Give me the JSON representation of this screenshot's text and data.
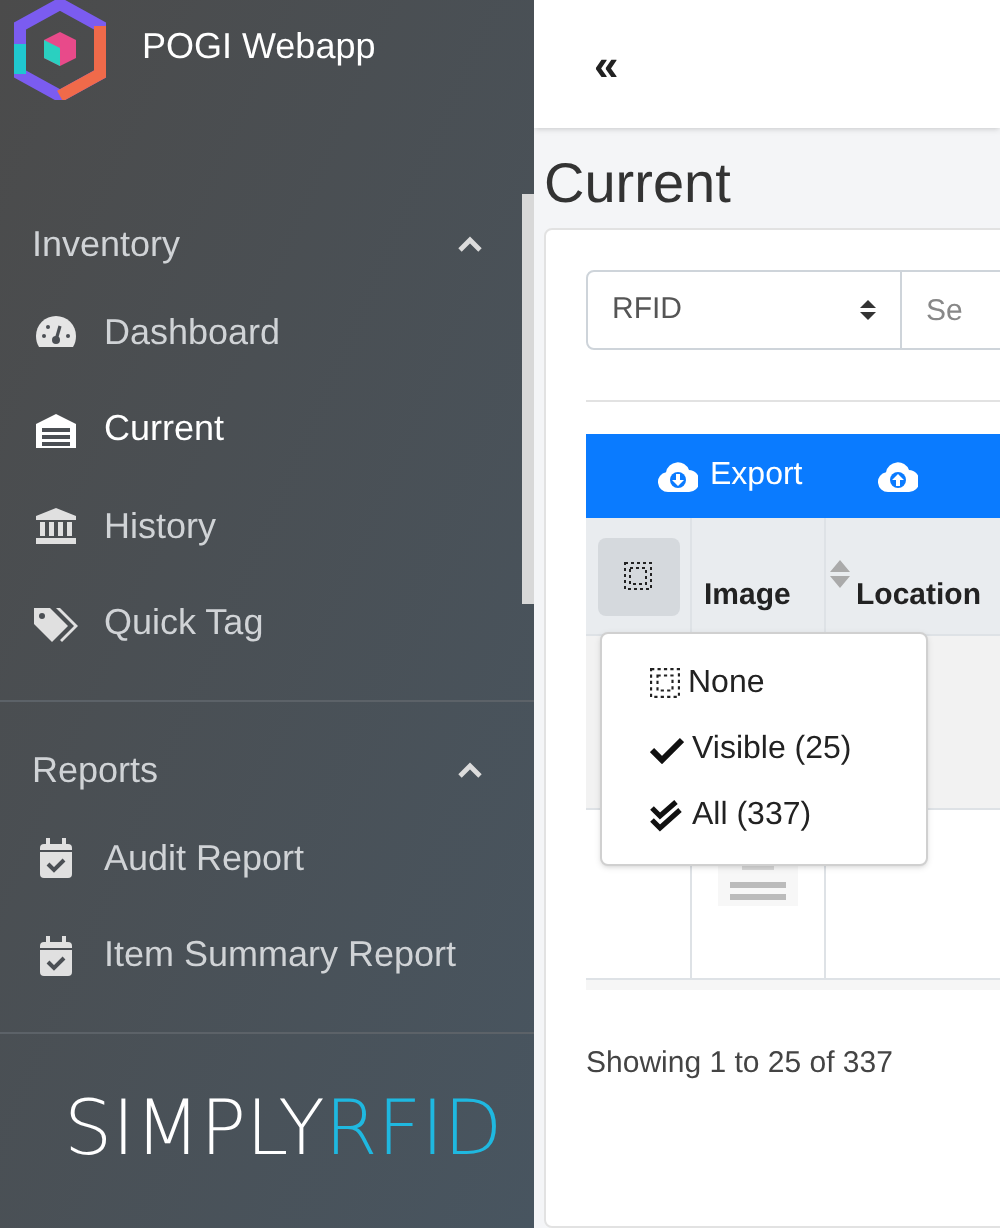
{
  "app": {
    "title": "POGI Webapp"
  },
  "sidebar": {
    "sections": [
      {
        "title": "Inventory",
        "expanded": true,
        "items": [
          {
            "label": "Dashboard",
            "kind": "gauge",
            "selected": false
          },
          {
            "label": "Current",
            "kind": "warehouse",
            "selected": true
          },
          {
            "label": "History",
            "kind": "bank",
            "selected": false
          },
          {
            "label": "Quick Tag",
            "kind": "tags",
            "selected": false
          }
        ]
      },
      {
        "title": "Reports",
        "expanded": true,
        "items": [
          {
            "label": "Audit Report",
            "kind": "calendar",
            "selected": false
          },
          {
            "label": "Item Summary Report",
            "kind": "calendar",
            "selected": false
          }
        ]
      }
    ],
    "brand": {
      "part_1": "SIMPLY",
      "part_2": "RFID"
    }
  },
  "topbar": {
    "collapse": "«"
  },
  "page": {
    "title": "Current",
    "filter": {
      "value": "RFID",
      "search_placeholder": "Se"
    },
    "toolbar": [
      {
        "label": "Export",
        "kind": "export"
      },
      {
        "kind": "import"
      }
    ],
    "table": {
      "columns": [
        "Image",
        "Location"
      ],
      "rows": [
        {
          "kind": "hidden"
        },
        {
          "kind": "picture"
        }
      ]
    },
    "select_menu": {
      "items": [
        {
          "label": "None",
          "kind": "none"
        },
        {
          "label": "Visible (25)",
          "kind": "visible"
        },
        {
          "label": "All (337)",
          "kind": "all"
        }
      ]
    },
    "footer": "Showing 1 to 25 of 337"
  }
}
